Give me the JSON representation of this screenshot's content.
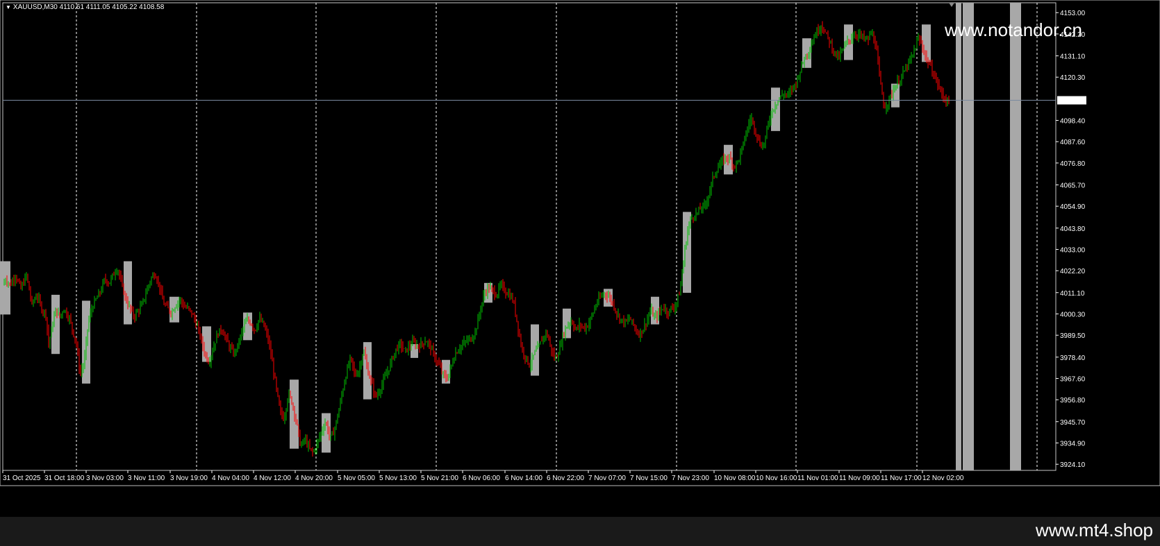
{
  "window": {
    "symbol_text": "XAUUSD,M30  4110.61 4111.05 4105.22 4108.58",
    "watermark": "www.notandor.cn",
    "footer": "www.mt4.shop",
    "current_price_label": "4108.58"
  },
  "colors": {
    "background": "#000000",
    "bull": "#00c000",
    "bear": "#ff0000",
    "box": "#a8a8a8",
    "grid": "#ffffff",
    "price_line": "#7a8aa0"
  },
  "chart_data": {
    "type": "candlestick",
    "title": "XAUUSD,M30",
    "ohlc_header": {
      "open": 4110.61,
      "high": 4111.05,
      "low": 4105.22,
      "close": 4108.58
    },
    "ylim": [
      3921,
      4158
    ],
    "y_ticks": [
      "4153.00",
      "4142.20",
      "4131.10",
      "4120.30",
      "4098.40",
      "4087.60",
      "4076.80",
      "4065.70",
      "4054.90",
      "4043.80",
      "4033.00",
      "4022.20",
      "4011.10",
      "4000.30",
      "3989.50",
      "3978.40",
      "3967.60",
      "3956.80",
      "3945.70",
      "3934.90",
      "3924.10"
    ],
    "x_ticks": [
      "31 Oct 2025",
      "31 Oct 18:00",
      "3 Nov 03:00",
      "3 Nov 11:00",
      "3 Nov 19:00",
      "4 Nov 04:00",
      "4 Nov 12:00",
      "4 Nov 20:00",
      "5 Nov 05:00",
      "5 Nov 13:00",
      "5 Nov 21:00",
      "6 Nov 06:00",
      "6 Nov 14:00",
      "6 Nov 22:00",
      "7 Nov 07:00",
      "7 Nov 15:00",
      "7 Nov 23:00",
      "10 Nov 08:00",
      "10 Nov 16:00",
      "11 Nov 01:00",
      "11 Nov 09:00",
      "11 Nov 17:00",
      "12 Nov 02:00"
    ],
    "current_price": 4108.58,
    "close_path": [
      [
        0,
        4012
      ],
      [
        8,
        4018
      ],
      [
        15,
        4015
      ],
      [
        22,
        4020
      ],
      [
        30,
        4013
      ],
      [
        38,
        4020
      ],
      [
        46,
        4005
      ],
      [
        53,
        4010
      ],
      [
        60,
        4003
      ],
      [
        66,
        4000
      ],
      [
        70,
        3985
      ],
      [
        74,
        3992
      ],
      [
        80,
        4002
      ],
      [
        86,
        3999
      ],
      [
        92,
        4003
      ],
      [
        100,
        3998
      ],
      [
        110,
        3985
      ],
      [
        115,
        3970
      ],
      [
        121,
        3975
      ],
      [
        127,
        3996
      ],
      [
        133,
        4004
      ],
      [
        139,
        4008
      ],
      [
        145,
        4012
      ],
      [
        151,
        4018
      ],
      [
        157,
        4016
      ],
      [
        163,
        4020
      ],
      [
        169,
        4024
      ],
      [
        175,
        4015
      ],
      [
        181,
        4008
      ],
      [
        187,
        4003
      ],
      [
        193,
        3999
      ],
      [
        199,
        4002
      ],
      [
        205,
        4005
      ],
      [
        211,
        4012
      ],
      [
        217,
        4018
      ],
      [
        223,
        4021
      ],
      [
        229,
        4015
      ],
      [
        235,
        4006
      ],
      [
        241,
        4003
      ],
      [
        247,
        4001
      ],
      [
        253,
        4005
      ],
      [
        259,
        4008
      ],
      [
        265,
        4004
      ],
      [
        271,
        4003
      ],
      [
        277,
        4000
      ],
      [
        283,
        3995
      ],
      [
        289,
        3988
      ],
      [
        295,
        3980
      ],
      [
        301,
        3976
      ],
      [
        307,
        3983
      ],
      [
        313,
        3990
      ],
      [
        319,
        3993
      ],
      [
        325,
        3988
      ],
      [
        331,
        3983
      ],
      [
        337,
        3980
      ],
      [
        343,
        3985
      ],
      [
        349,
        3992
      ],
      [
        355,
        3997
      ],
      [
        361,
        3996
      ],
      [
        367,
        3992
      ],
      [
        373,
        3998
      ],
      [
        379,
        3995
      ],
      [
        385,
        3989
      ],
      [
        391,
        3978
      ],
      [
        397,
        3964
      ],
      [
        403,
        3951
      ],
      [
        409,
        3947
      ],
      [
        415,
        3960
      ],
      [
        421,
        3955
      ],
      [
        427,
        3945
      ],
      [
        433,
        3933
      ],
      [
        439,
        3937
      ],
      [
        445,
        3932
      ],
      [
        451,
        3930
      ],
      [
        457,
        3935
      ],
      [
        463,
        3941
      ],
      [
        469,
        3946
      ],
      [
        475,
        3937
      ],
      [
        481,
        3941
      ],
      [
        487,
        3950
      ],
      [
        493,
        3961
      ],
      [
        499,
        3971
      ],
      [
        505,
        3978
      ],
      [
        511,
        3969
      ],
      [
        517,
        3972
      ],
      [
        523,
        3982
      ],
      [
        529,
        3972
      ],
      [
        535,
        3965
      ],
      [
        541,
        3958
      ],
      [
        547,
        3962
      ],
      [
        553,
        3967
      ],
      [
        559,
        3972
      ],
      [
        565,
        3978
      ],
      [
        571,
        3983
      ],
      [
        577,
        3985
      ],
      [
        583,
        3981
      ],
      [
        589,
        3984
      ],
      [
        595,
        3986
      ],
      [
        601,
        3984
      ],
      [
        607,
        3985
      ],
      [
        613,
        3987
      ],
      [
        619,
        3984
      ],
      [
        625,
        3979
      ],
      [
        631,
        3975
      ],
      [
        637,
        3970
      ],
      [
        643,
        3967
      ],
      [
        649,
        3973
      ],
      [
        655,
        3980
      ],
      [
        661,
        3983
      ],
      [
        667,
        3985
      ],
      [
        673,
        3987
      ],
      [
        679,
        3988
      ],
      [
        685,
        3992
      ],
      [
        691,
        4002
      ],
      [
        697,
        4010
      ],
      [
        703,
        4014
      ],
      [
        709,
        4012
      ],
      [
        715,
        4010
      ],
      [
        721,
        4015
      ],
      [
        727,
        4012
      ],
      [
        733,
        4010
      ],
      [
        739,
        4007
      ],
      [
        745,
        3995
      ],
      [
        751,
        3983
      ],
      [
        757,
        3978
      ],
      [
        763,
        3974
      ],
      [
        769,
        3980
      ],
      [
        775,
        3983
      ],
      [
        781,
        3988
      ],
      [
        787,
        3991
      ],
      [
        793,
        3983
      ],
      [
        799,
        3977
      ],
      [
        805,
        3982
      ],
      [
        811,
        3990
      ],
      [
        817,
        3995
      ],
      [
        823,
        3997
      ],
      [
        829,
        3992
      ],
      [
        835,
        3995
      ],
      [
        841,
        3993
      ],
      [
        847,
        3995
      ],
      [
        853,
        4000
      ],
      [
        859,
        4006
      ],
      [
        865,
        4009
      ],
      [
        871,
        4011
      ],
      [
        877,
        4009
      ],
      [
        883,
        4005
      ],
      [
        889,
        4000
      ],
      [
        895,
        3997
      ],
      [
        901,
        3996
      ],
      [
        907,
        3998
      ],
      [
        913,
        3994
      ],
      [
        919,
        3990
      ],
      [
        925,
        3992
      ],
      [
        931,
        3997
      ],
      [
        937,
        4002
      ],
      [
        943,
        3998
      ],
      [
        949,
        4001
      ],
      [
        955,
        4004
      ],
      [
        961,
        4001
      ],
      [
        967,
        4003
      ],
      [
        973,
        4005
      ],
      [
        979,
        4012
      ],
      [
        985,
        4030
      ],
      [
        991,
        4045
      ],
      [
        997,
        4050
      ],
      [
        1003,
        4051
      ],
      [
        1009,
        4054
      ],
      [
        1015,
        4055
      ],
      [
        1021,
        4062
      ],
      [
        1027,
        4070
      ],
      [
        1033,
        4074
      ],
      [
        1039,
        4077
      ],
      [
        1045,
        4080
      ],
      [
        1051,
        4079
      ],
      [
        1057,
        4075
      ],
      [
        1063,
        4078
      ],
      [
        1069,
        4085
      ],
      [
        1075,
        4093
      ],
      [
        1081,
        4100
      ],
      [
        1087,
        4094
      ],
      [
        1093,
        4087
      ],
      [
        1099,
        4085
      ],
      [
        1105,
        4095
      ],
      [
        1111,
        4103
      ],
      [
        1117,
        4107
      ],
      [
        1123,
        4110
      ],
      [
        1129,
        4112
      ],
      [
        1135,
        4111
      ],
      [
        1141,
        4115
      ],
      [
        1147,
        4118
      ],
      [
        1153,
        4125
      ],
      [
        1159,
        4131
      ],
      [
        1165,
        4134
      ],
      [
        1171,
        4140
      ],
      [
        1177,
        4144
      ],
      [
        1183,
        4147
      ],
      [
        1189,
        4142
      ],
      [
        1195,
        4138
      ],
      [
        1201,
        4133
      ],
      [
        1207,
        4130
      ],
      [
        1213,
        4134
      ],
      [
        1219,
        4138
      ],
      [
        1225,
        4140
      ],
      [
        1231,
        4142
      ],
      [
        1237,
        4142
      ],
      [
        1243,
        4140
      ],
      [
        1249,
        4139
      ],
      [
        1255,
        4143
      ],
      [
        1261,
        4136
      ],
      [
        1267,
        4118
      ],
      [
        1273,
        4105
      ],
      [
        1279,
        4108
      ],
      [
        1285,
        4113
      ],
      [
        1291,
        4117
      ],
      [
        1297,
        4120
      ],
      [
        1303,
        4124
      ],
      [
        1309,
        4128
      ],
      [
        1315,
        4132
      ],
      [
        1321,
        4140
      ],
      [
        1327,
        4137
      ],
      [
        1333,
        4130
      ],
      [
        1339,
        4126
      ],
      [
        1345,
        4121
      ],
      [
        1351,
        4116
      ],
      [
        1357,
        4111
      ],
      [
        1363,
        4108
      ],
      [
        1367,
        4108.6
      ]
    ],
    "boxes": [
      {
        "x0": 0,
        "x1": 15,
        "hi": 4027,
        "lo": 4000
      },
      {
        "x0": 74,
        "x1": 86,
        "hi": 4010,
        "lo": 3980
      },
      {
        "x0": 118,
        "x1": 130,
        "hi": 4007,
        "lo": 3965
      },
      {
        "x0": 178,
        "x1": 190,
        "hi": 4027,
        "lo": 3995
      },
      {
        "x0": 244,
        "x1": 258,
        "hi": 4009,
        "lo": 3996
      },
      {
        "x0": 291,
        "x1": 304,
        "hi": 3994,
        "lo": 3976
      },
      {
        "x0": 350,
        "x1": 363,
        "hi": 4001,
        "lo": 3987
      },
      {
        "x0": 417,
        "x1": 430,
        "hi": 3967,
        "lo": 3932
      },
      {
        "x0": 463,
        "x1": 476,
        "hi": 3950,
        "lo": 3930
      },
      {
        "x0": 523,
        "x1": 535,
        "hi": 3986,
        "lo": 3957
      },
      {
        "x0": 591,
        "x1": 602,
        "hi": 3985,
        "lo": 3978
      },
      {
        "x0": 636,
        "x1": 648,
        "hi": 3977,
        "lo": 3965
      },
      {
        "x0": 697,
        "x1": 709,
        "hi": 4016,
        "lo": 4006
      },
      {
        "x0": 764,
        "x1": 776,
        "hi": 3995,
        "lo": 3969
      },
      {
        "x0": 810,
        "x1": 822,
        "hi": 4003,
        "lo": 3988
      },
      {
        "x0": 869,
        "x1": 882,
        "hi": 4013,
        "lo": 4004
      },
      {
        "x0": 937,
        "x1": 949,
        "hi": 4009,
        "lo": 3995
      },
      {
        "x0": 983,
        "x1": 995,
        "hi": 4052,
        "lo": 4011
      },
      {
        "x0": 1042,
        "x1": 1055,
        "hi": 4086,
        "lo": 4071
      },
      {
        "x0": 1110,
        "x1": 1123,
        "hi": 4115,
        "lo": 4093
      },
      {
        "x0": 1155,
        "x1": 1168,
        "hi": 4140,
        "lo": 4125
      },
      {
        "x0": 1215,
        "x1": 1228,
        "hi": 4147,
        "lo": 4129
      },
      {
        "x0": 1283,
        "x1": 1295,
        "hi": 4117,
        "lo": 4105
      },
      {
        "x0": 1327,
        "x1": 1340,
        "hi": 4147,
        "lo": 4128
      }
    ],
    "gray_bars": [
      {
        "x0": 1376,
        "x1": 1384
      },
      {
        "x0": 1386,
        "x1": 1402
      },
      {
        "x0": 1454,
        "x1": 1470
      }
    ]
  }
}
